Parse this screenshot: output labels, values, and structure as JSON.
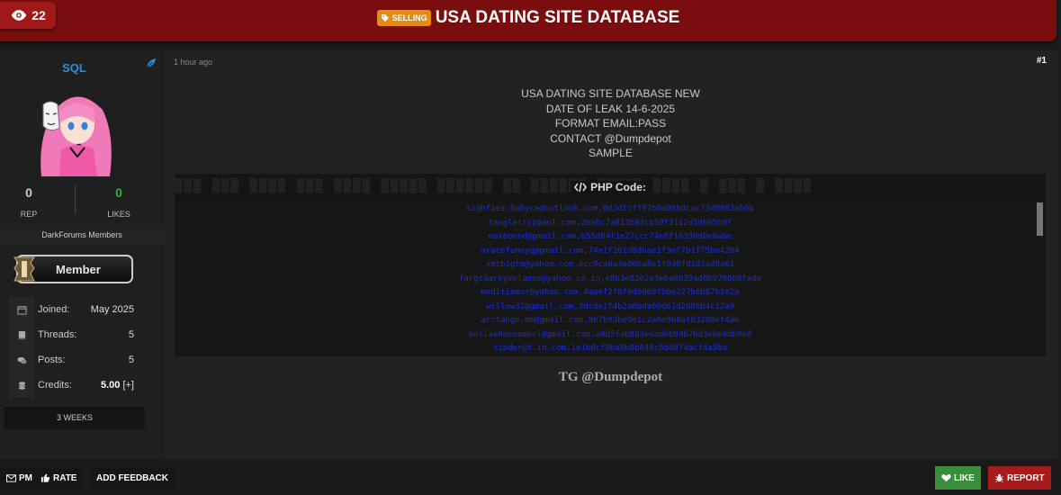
{
  "header": {
    "views_count": "22",
    "badge_label": "SELLING",
    "thread_title": "USA DATING SITE DATABASE"
  },
  "user": {
    "username": "SQL",
    "rep_value": "0",
    "rep_label": "REP",
    "likes_value": "0",
    "likes_label": "LIKES",
    "group": "DarkForums Members",
    "rank": "Member",
    "info": [
      {
        "key": "Joined:",
        "value": "May 2025",
        "icon": "calendar-icon"
      },
      {
        "key": "Threads:",
        "value": "5",
        "icon": "book-icon"
      },
      {
        "key": "Posts:",
        "value": "5",
        "icon": "comments-icon"
      },
      {
        "key": "Credits:",
        "value": "5.00",
        "extra": "[+]",
        "icon": "coins-icon"
      }
    ],
    "membership_age": "3 WEEKS"
  },
  "post": {
    "time": "1 hour ago",
    "number": "#1",
    "lines": [
      "USA DATING SITE DATABASE NEW",
      "DATE OF LEAK 14-6-2025",
      "FORMAT EMAIL:PASS",
      "CONTACT @Dumpdepot",
      "SAMPLE"
    ],
    "code_label": "PHP Code:",
    "code_ghost": "▒▒▒ ▒▒▒ ▒▒▒▒ ▒▒▒ ▒▒▒▒ ▒▒▒▒▒ ▒▒▒▒▒▒ ▒▒ ▒▒▒▒▒▒ ▒▒▒▒▒ ▒▒▒▒ ▒ ▒▒▒ ▒ ▒▒▒▒",
    "code_lines": [
      "sighfies.babyce@outlook.com,0d3d1cff97b8a08bdcac73d8802ab6b",
      "tangletrip@aol.com,2ba8c7a812b03cb59f3112d50b65b9f",
      "maxbound@gmail.com,b55d04f1e27ccc74e6f16390d0e6abe",
      "aracefunnyq@gmail.com,74e1f201d8dbae1f3ef7b1f75be4204",
      "xmtbigtm@yahoo.com,ecc9ca8a3e80ba8e1f0d0fd1d3ad9a61",
      "fargtdarkyeelamse@yahoo.co.in,e8b3e82e2e3eba8b39ad0b9706b8fade",
      "meditiemur@yahoo.com,4aaef2f8f0d0d68fb6e227b6b87b1e2a",
      "willow32@gmail.com,3dcde1f4b2a8bda6bd61d2686b4c12a9",
      "arctange.mm@gmail.com,8b7b93be9e1c2a8e9b8afb3280ef4ae",
      "bellaa8neoamerl@gmail.com,a8d5fab8b3eeadbb9db7bd3ebe4db9e8",
      "tinder@t.in.com,1e1b0cf9ba8b8b848c8dd874acf4a5ba"
    ],
    "signature": "TG @Dumpdepot"
  },
  "footer": {
    "pm": "PM",
    "rate": "RATE",
    "add_feedback": "ADD FEEDBACK",
    "like": "LIKE",
    "report": "REPORT"
  },
  "colors": {
    "header_bg": "#7a0e0e",
    "badge": "#e58a12",
    "username": "#2a8fde",
    "rep_value": "#cccccc",
    "likes_value": "#3fae3f",
    "code_text": "#1a2fd6",
    "like_button": "#3a8d3a",
    "report_button": "#a51a1a"
  }
}
